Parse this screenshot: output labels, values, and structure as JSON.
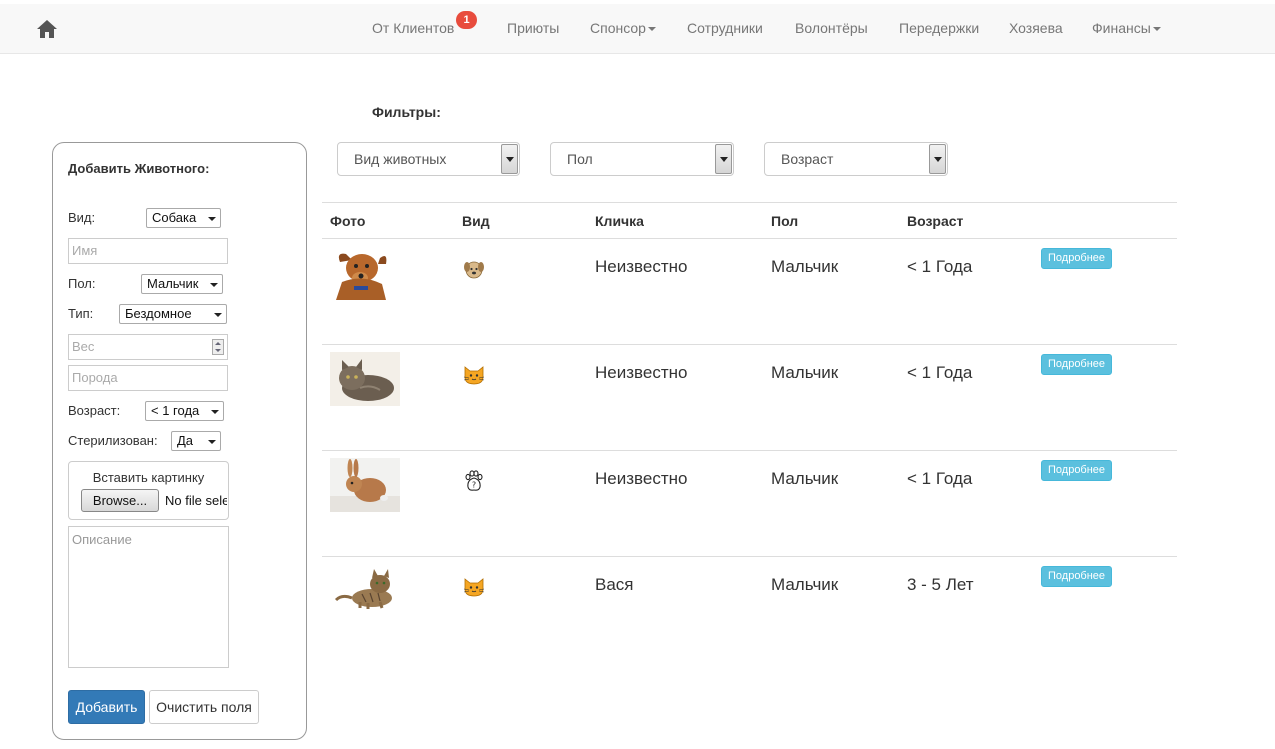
{
  "nav": {
    "items": [
      {
        "label": "От Клиентов",
        "badge": "1"
      },
      {
        "label": "Приюты"
      },
      {
        "label": "Спонсор"
      },
      {
        "label": "Сотрудники"
      },
      {
        "label": "Волонтёры"
      },
      {
        "label": "Передержки"
      },
      {
        "label": "Хозяева"
      },
      {
        "label": "Финансы"
      }
    ]
  },
  "filters": {
    "label": "Фильтры:",
    "animal_type": "Вид животных",
    "sex": "Пол",
    "age": "Возраст"
  },
  "table": {
    "headers": [
      "Фото",
      "Вид",
      "Кличка",
      "Пол",
      "Возраст"
    ],
    "rows": [
      {
        "photo": "dog-photo",
        "species_icon": "dog-icon",
        "name": "Неизвестно",
        "sex": "Мальчик",
        "age": "< 1 Года",
        "details": "Подробнее"
      },
      {
        "photo": "cat-photo",
        "species_icon": "cat-icon",
        "name": "Неизвестно",
        "sex": "Мальчик",
        "age": "< 1 Года",
        "details": "Подробнее"
      },
      {
        "photo": "rabbit-photo",
        "species_icon": "paw-icon",
        "name": "Неизвестно",
        "sex": "Мальчик",
        "age": "< 1 Года",
        "details": "Подробнее"
      },
      {
        "photo": "cat-photo",
        "species_icon": "cat-icon",
        "name": "Вася",
        "sex": "Мальчик",
        "age": "3 - 5 Лет",
        "details": "Подробнее"
      }
    ]
  },
  "form": {
    "title": "Добавить Животного:",
    "kind_label": "Вид:",
    "kind_value": "Собака",
    "name_placeholder": "Имя",
    "sex_label": "Пол:",
    "sex_value": "Мальчик",
    "type_label": "Тип:",
    "type_value": "Бездомное",
    "weight_placeholder": "Вес",
    "breed_placeholder": "Порода",
    "age_label": "Возраст:",
    "age_value": "< 1 года",
    "sterilized_label": "Стерилизован:",
    "sterilized_value": "Да",
    "image_label": "Вставить картинку",
    "browse_label": "Browse...",
    "file_status": "No file selected.",
    "description_placeholder": "Описание",
    "add_label": "Добавить",
    "clear_label": "Очистить поля"
  },
  "colors": {
    "primary": "#337ab7",
    "info": "#5bc0de",
    "badge": "#e84c3d",
    "navbar": "#f8f8f8"
  }
}
